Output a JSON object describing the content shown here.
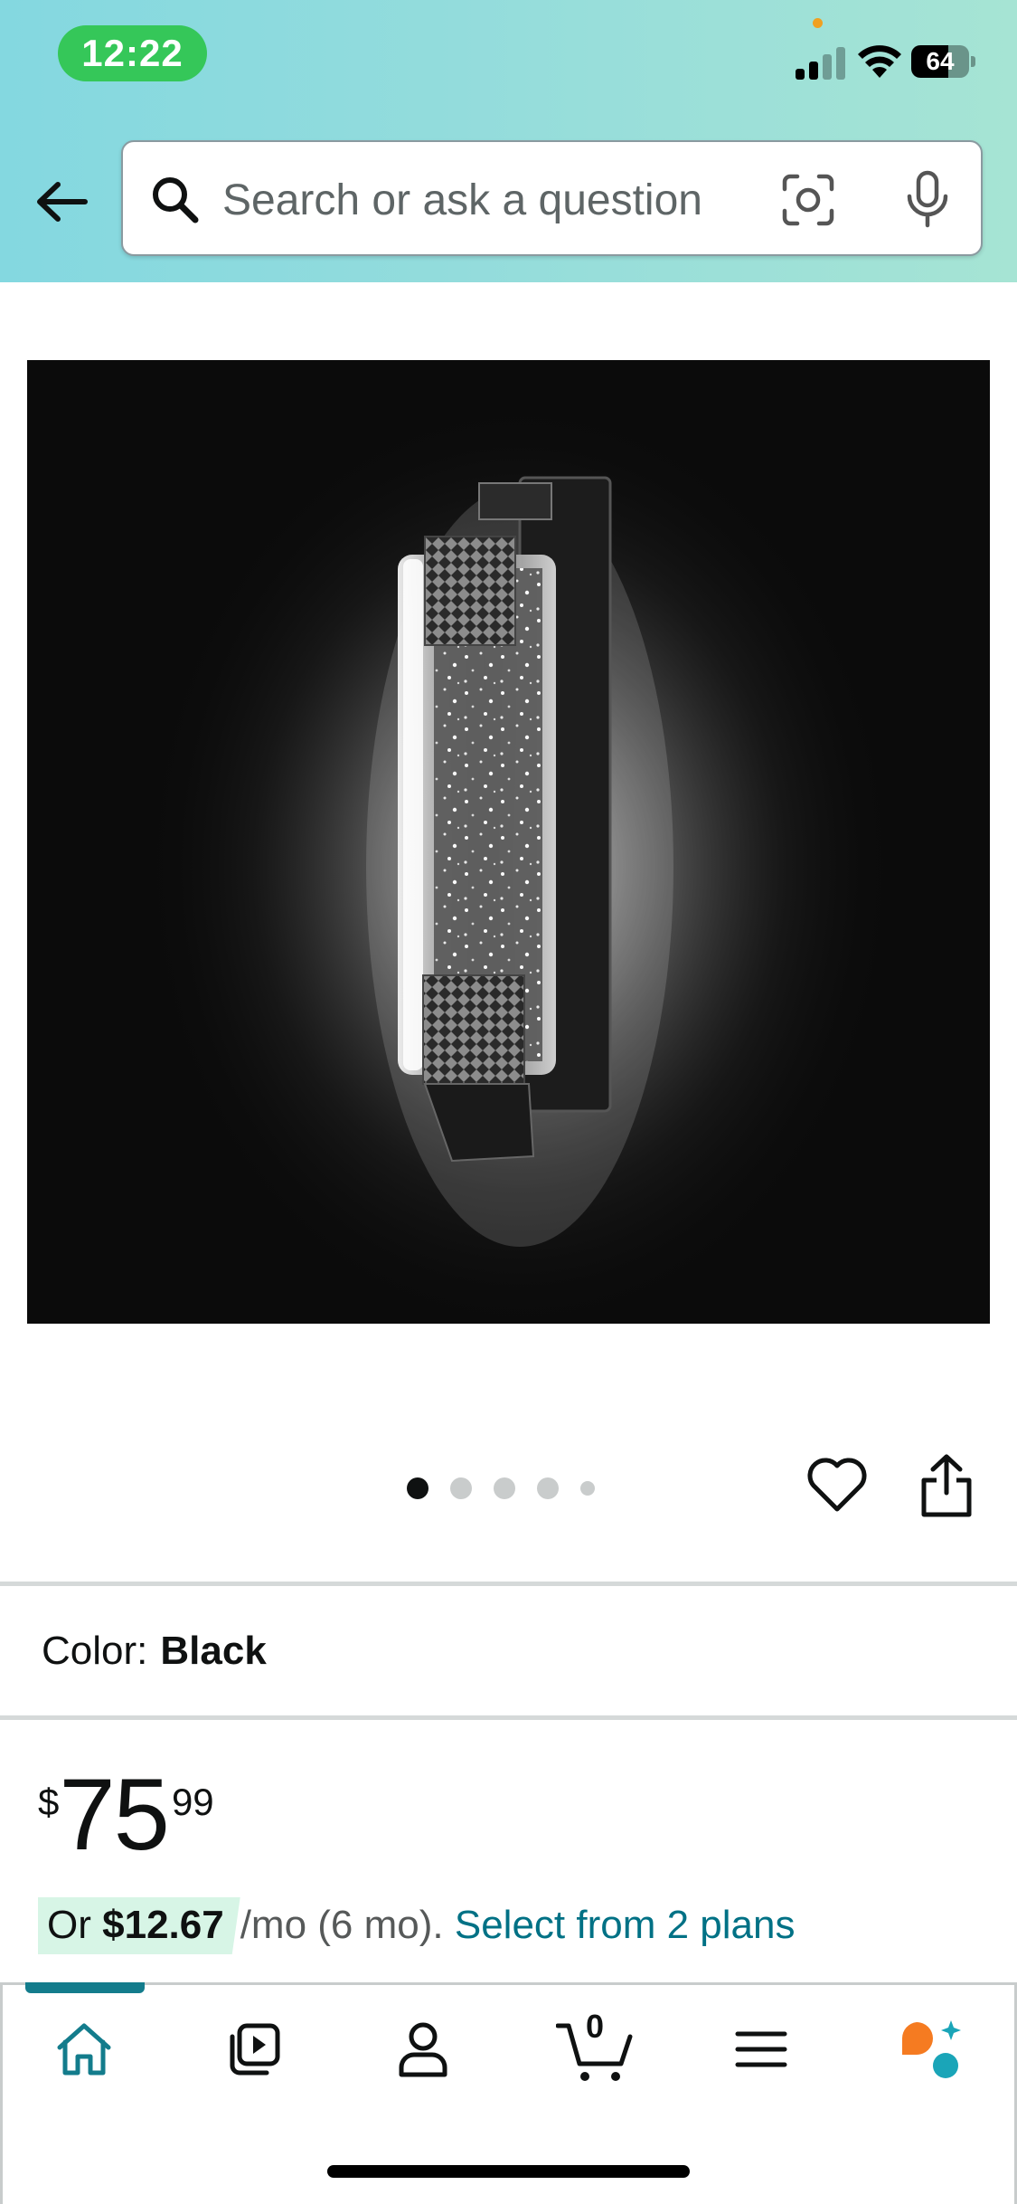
{
  "status_bar": {
    "time": "12:22",
    "battery": "64",
    "battery_level_percent": 64,
    "signal_bars_active": 2,
    "signal_bars_total": 4
  },
  "search": {
    "placeholder": "Search or ask a question"
  },
  "icons": {
    "back": "back-arrow-icon",
    "search": "search-icon",
    "camera": "camera-lens-icon",
    "mic": "microphone-icon",
    "heart": "heart-icon",
    "share": "share-icon",
    "home": "home-icon",
    "video": "video-play-icon",
    "account": "person-icon",
    "cart": "cart-icon",
    "menu": "menu-icon",
    "rufus": "rufus-assistant-icon"
  },
  "image_carousel": {
    "total": 5,
    "active_index": 0
  },
  "color": {
    "label": "Color:",
    "value": "Black"
  },
  "price": {
    "symbol": "$",
    "whole": "75",
    "fraction": "99"
  },
  "monthly": {
    "prefix": "Or",
    "amount": "$12.67",
    "terms": "/mo (6 mo).",
    "link": "Select from 2 plans"
  },
  "tabbar": {
    "cart_count": "0",
    "active_tab": "home"
  },
  "colors": {
    "accent_teal": "#137c8c",
    "link": "#007185",
    "highlight": "#d7f5e6",
    "status_green": "#35c759"
  }
}
